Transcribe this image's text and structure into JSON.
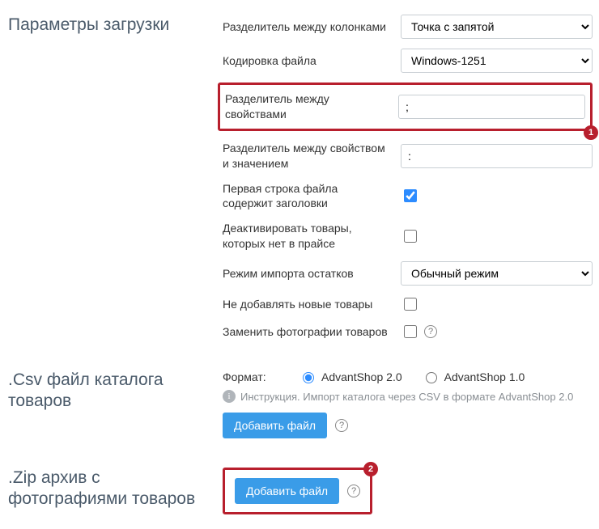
{
  "params": {
    "title": "Параметры загрузки",
    "col_sep_label": "Разделитель между колонками",
    "col_sep_value": "Точка с запятой",
    "encoding_label": "Кодировка файла",
    "encoding_value": "Windows-1251",
    "prop_sep_label": "Разделитель между свойствами",
    "prop_sep_value": ";",
    "prop_val_sep_label": "Разделитель между свойством и значением",
    "prop_val_sep_value": ":",
    "header_row_label": "Первая строка файла содержит заголовки",
    "deactivate_label": "Деактивировать товары, которых нет в прайсе",
    "stock_mode_label": "Режим импорта остатков",
    "stock_mode_value": "Обычный режим",
    "no_new_label": "Не добавлять новые товары",
    "replace_photos_label": "Заменить фотографии товаров"
  },
  "csv": {
    "title": ".Csv файл каталога товаров",
    "format_label": "Формат:",
    "opt1": "AdvantShop 2.0",
    "opt2": "AdvantShop 1.0",
    "info_text": "Инструкция. Импорт каталога через CSV в формате AdvantShop 2.0",
    "add_btn": "Добавить файл"
  },
  "zip": {
    "title": ".Zip архив с фотографиями товаров",
    "add_btn": "Добавить файл"
  },
  "badges": {
    "b1": "1",
    "b2": "2"
  }
}
